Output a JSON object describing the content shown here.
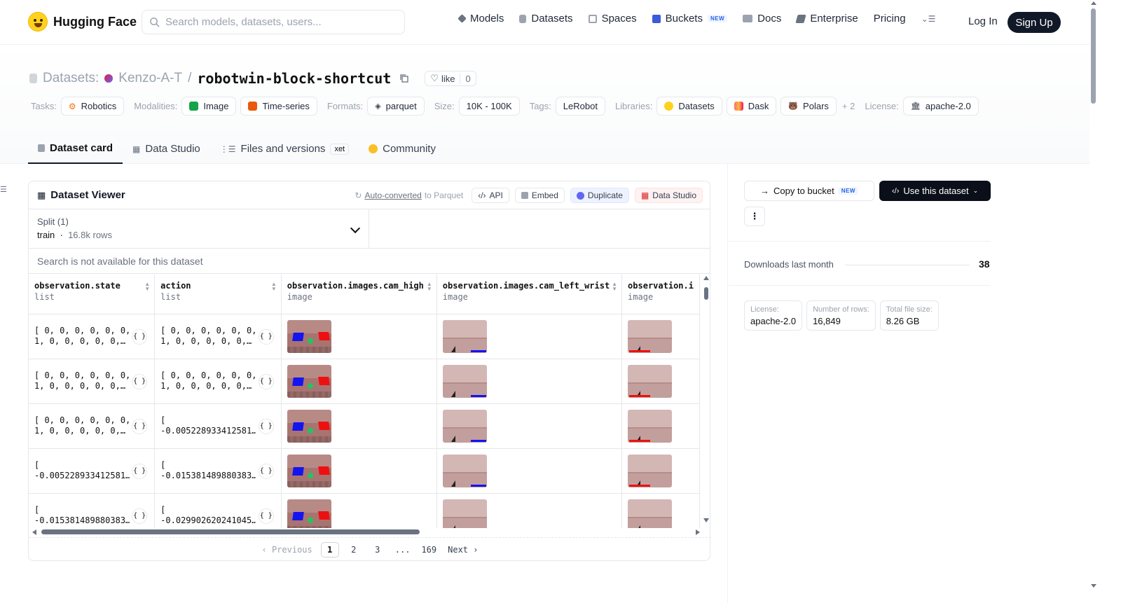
{
  "nav": {
    "brand": "Hugging Face",
    "search_placeholder": "Search models, datasets, users...",
    "links": [
      {
        "label": "Models",
        "icon": "models-icon"
      },
      {
        "label": "Datasets",
        "icon": "datasets-icon"
      },
      {
        "label": "Spaces",
        "icon": "spaces-icon"
      },
      {
        "label": "Buckets",
        "icon": "buckets-icon",
        "badge": "NEW"
      },
      {
        "label": "Docs",
        "icon": "docs-icon"
      },
      {
        "label": "Enterprise",
        "icon": "enterprise-icon"
      },
      {
        "label": "Pricing"
      }
    ],
    "login": "Log In",
    "signup": "Sign Up"
  },
  "header": {
    "section_label": "Datasets:",
    "owner": "Kenzo-A-T",
    "separator": "/",
    "repo_name": "robotwin-block-shortcut",
    "like_label": "like",
    "like_count": "0",
    "tasks_label": "Tasks:",
    "tasks": [
      "Robotics"
    ],
    "modalities_label": "Modalities:",
    "modalities": [
      "Image",
      "Time-series"
    ],
    "formats_label": "Formats:",
    "formats": [
      "parquet"
    ],
    "size_label": "Size:",
    "size": "10K - 100K",
    "tags_label": "Tags:",
    "tags": [
      "LeRobot"
    ],
    "libraries_label": "Libraries:",
    "libraries": [
      "Datasets",
      "Dask",
      "Polars"
    ],
    "libraries_more": "+ 2",
    "license_label": "License:",
    "license": "apache-2.0",
    "tabs": [
      {
        "label": "Dataset card",
        "active": true
      },
      {
        "label": "Data Studio"
      },
      {
        "label": "Files and versions",
        "badge": "xet"
      },
      {
        "label": "Community"
      }
    ]
  },
  "viewer": {
    "title": "Dataset Viewer",
    "auto_converted_link": "Auto-converted",
    "auto_converted_rest": "to Parquet",
    "buttons": {
      "api": "API",
      "embed": "Embed",
      "duplicate": "Duplicate",
      "data_studio": "Data Studio"
    },
    "split_title": "Split (1)",
    "split_name": "train",
    "split_rows": "16.8k rows",
    "search_note": "Search is not available for this dataset",
    "columns": [
      {
        "name": "observation.state",
        "type": "list"
      },
      {
        "name": "action",
        "type": "list"
      },
      {
        "name": "observation.images.cam_high",
        "type": "image"
      },
      {
        "name": "observation.images.cam_left_wrist",
        "type": "image"
      },
      {
        "name": "observation.i",
        "type": "image"
      }
    ],
    "rows": [
      {
        "state": "[ 0, 0, 0, 0, 0, 0,\n1, 0, 0, 0, 0, 0,…",
        "action": "[ 0, 0, 0, 0, 0, 0,\n1, 0, 0, 0, 0, 0,…"
      },
      {
        "state": "[ 0, 0, 0, 0, 0, 0,\n1, 0, 0, 0, 0, 0,…",
        "action": "[ 0, 0, 0, 0, 0, 0,\n1, 0, 0, 0, 0, 0,…"
      },
      {
        "state": "[ 0, 0, 0, 0, 0, 0,\n1, 0, 0, 0, 0, 0,…",
        "action": "[\n-0.005228933412581…"
      },
      {
        "state": "[\n-0.005228933412581…",
        "action": "[\n-0.015381489880383…"
      },
      {
        "state": "[\n-0.015381489880383…",
        "action": "[\n-0.029902620241045…"
      }
    ],
    "json_glyph": "{ }",
    "pager": {
      "previous": "Previous",
      "pages": [
        "1",
        "2",
        "3",
        "...",
        "169"
      ],
      "current": "1",
      "next": "Next"
    }
  },
  "sidebar": {
    "copy_bucket": "Copy to bucket",
    "copy_bucket_badge": "NEW",
    "use_dataset": "Use this dataset",
    "downloads_label": "Downloads last month",
    "downloads_count": "38",
    "stats": [
      {
        "k": "License:",
        "v": "apache-2.0"
      },
      {
        "k": "Number of rows:",
        "v": "16,849"
      },
      {
        "k": "Total file size:",
        "v": "8.26 GB"
      }
    ]
  },
  "colors": {
    "brand_yellow": "#ffd21e",
    "dark_button": "#0b0f19",
    "new_badge": "#2563eb"
  }
}
